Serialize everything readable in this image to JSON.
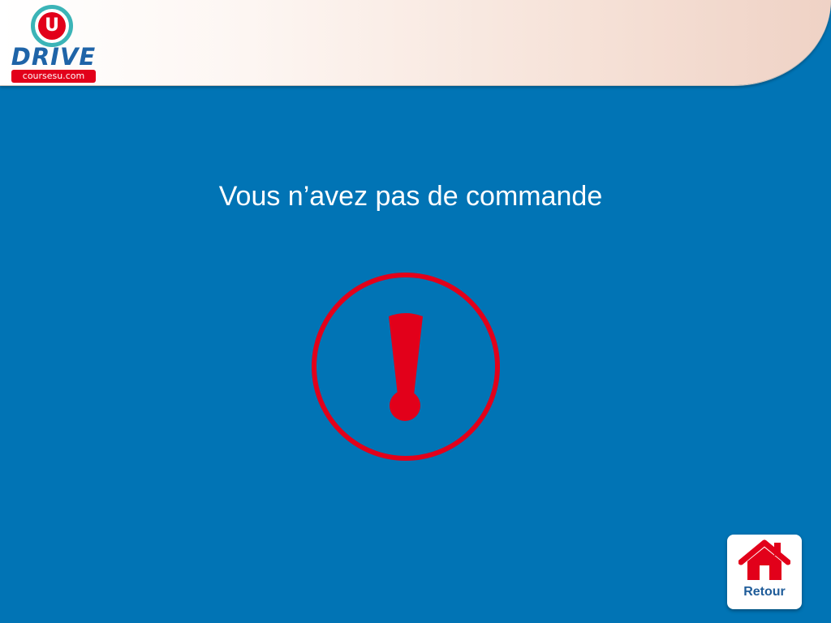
{
  "header": {
    "logo": {
      "badge_letter": "U",
      "brand": "DRIVE",
      "site": "coursesu.com"
    }
  },
  "main": {
    "message": "Vous n’avez pas de commande",
    "alert_icon": "exclamation-circle-icon"
  },
  "footer": {
    "back_button": {
      "label": "Retour",
      "icon": "home-icon"
    }
  },
  "colors": {
    "background": "#0174B5",
    "alert_red": "#E2001A",
    "brand_blue": "#1F64A8",
    "brand_teal": "#3BB4B7"
  }
}
